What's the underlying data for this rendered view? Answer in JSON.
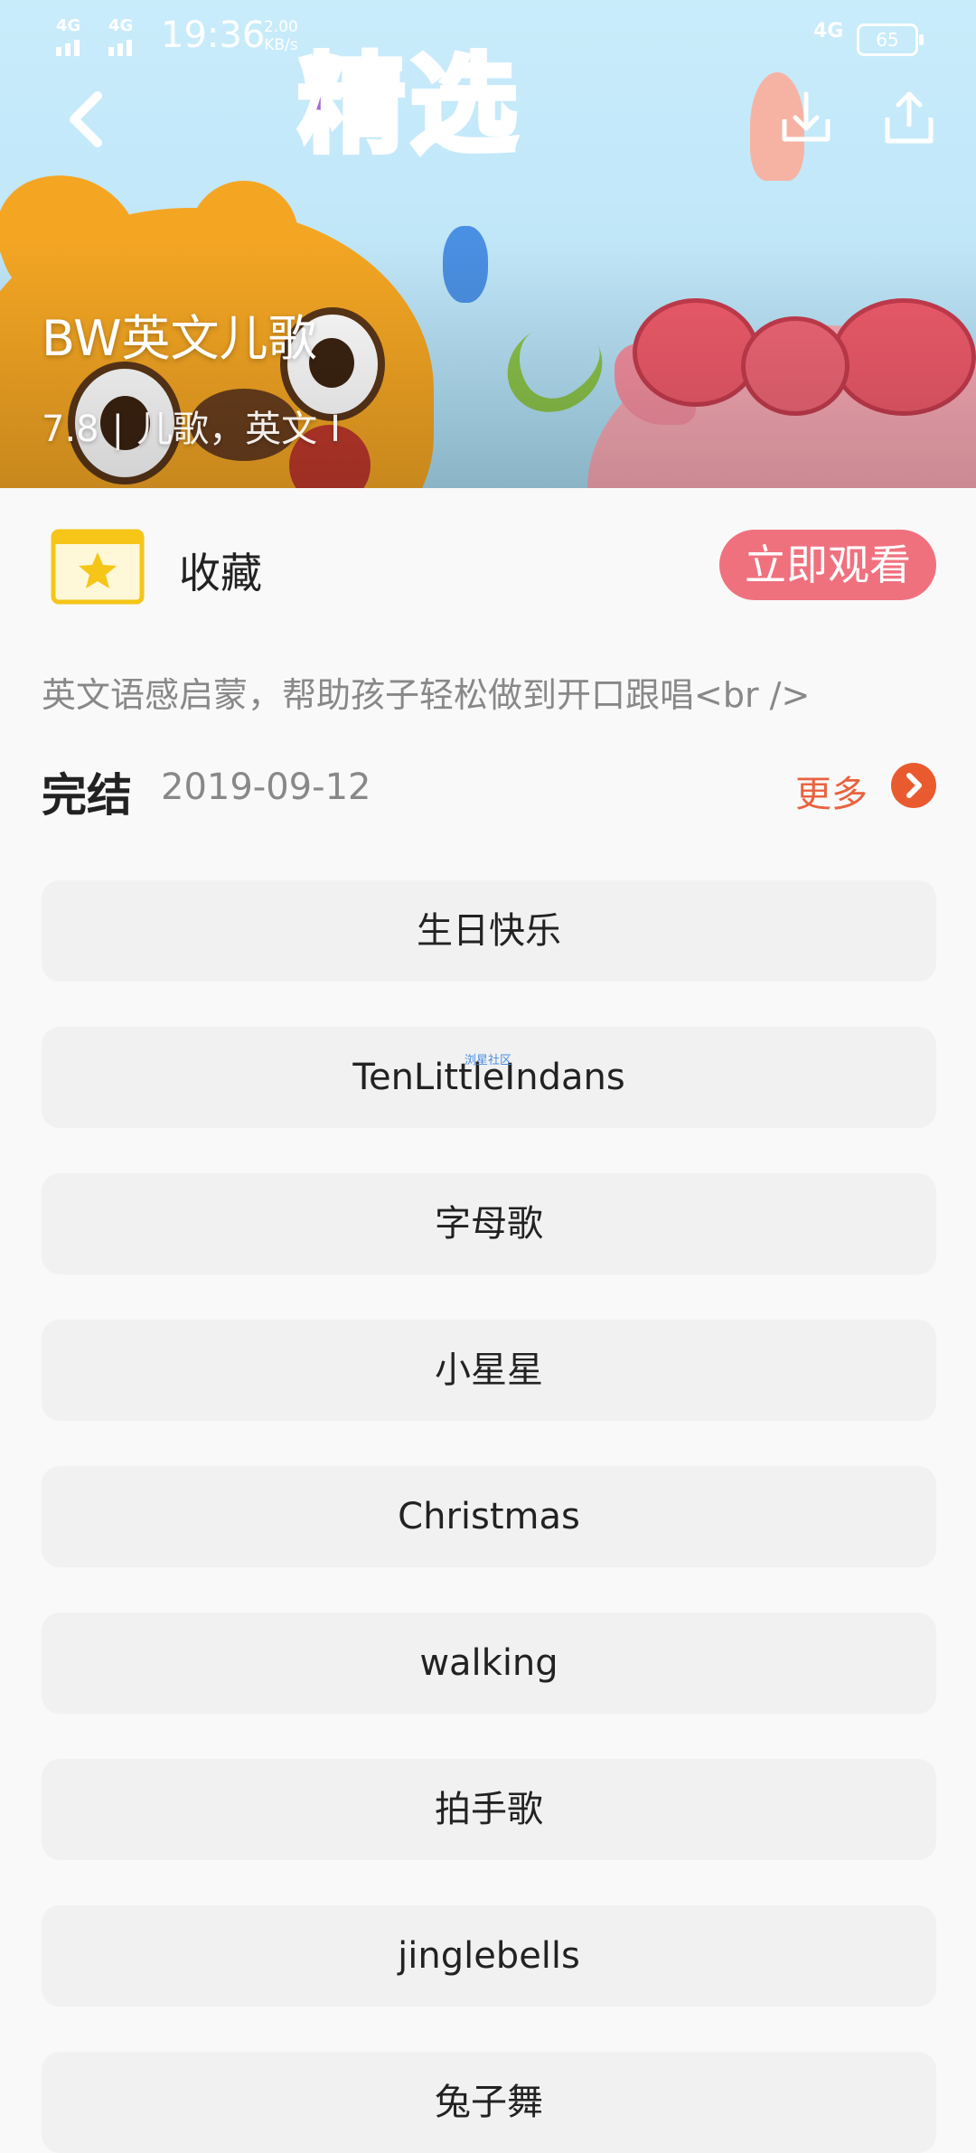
{
  "status_bar": {
    "network_left_1": "4G",
    "network_left_2": "4G",
    "time": "19:36",
    "speed_value": "2.00",
    "speed_unit": "KB/s",
    "network_right": "4G",
    "battery": "65"
  },
  "hero": {
    "banner_text": "精选",
    "title": "BW英文儿歌",
    "meta_score": "7.8",
    "meta_tags": "儿歌，英文",
    "meta_trailing": "I"
  },
  "actions": {
    "favorite_label": "收藏",
    "watch_now_label": "立即观看",
    "accent_color": "#f0717e"
  },
  "description": "英文语感启蒙，帮助孩子轻松做到开口跟唱<br />",
  "status": {
    "label": "完结",
    "date": "2019-09-12",
    "more_label": "更多",
    "more_color": "#e9633f"
  },
  "watermark": "浏星社区",
  "episodes": [
    {
      "title": "生日快乐"
    },
    {
      "title": "TenLittleIndans"
    },
    {
      "title": "字母歌"
    },
    {
      "title": "小星星"
    },
    {
      "title": "Christmas"
    },
    {
      "title": "walking"
    },
    {
      "title": "拍手歌"
    },
    {
      "title": "jinglebells"
    },
    {
      "title": "兔子舞"
    }
  ]
}
